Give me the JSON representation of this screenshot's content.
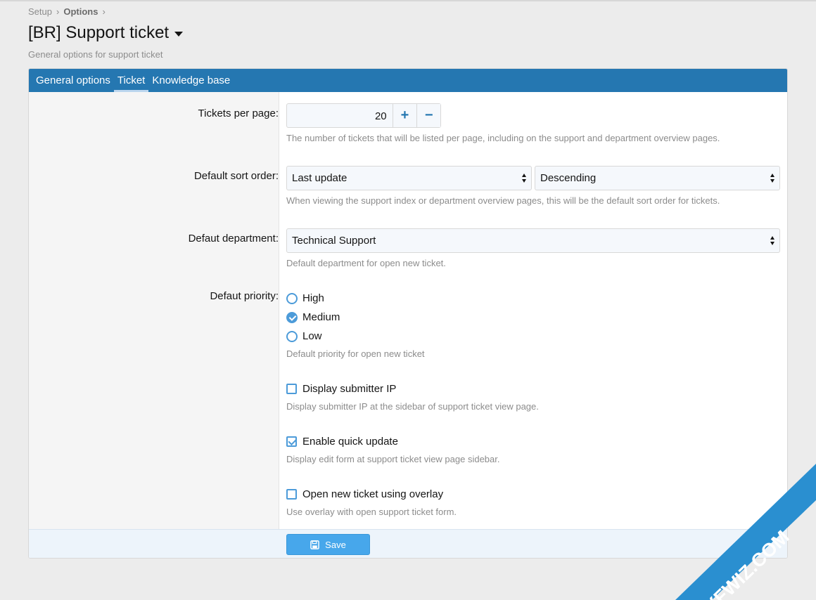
{
  "breadcrumb": {
    "items": [
      "Setup",
      "Options"
    ]
  },
  "page": {
    "title": "[BR] Support ticket",
    "description": "General options for support ticket"
  },
  "tabs": [
    "General options",
    "Ticket",
    "Knowledge base"
  ],
  "active_tab": "Ticket",
  "fields": {
    "tickets_per_page": {
      "label": "Tickets per page:",
      "value": "20",
      "hint": "The number of tickets that will be listed per page, including on the support and department overview pages."
    },
    "sort_order": {
      "label": "Default sort order:",
      "order_value": "Last update",
      "direction_value": "Descending",
      "hint": "When viewing the support index or department overview pages, this will be the default sort order for tickets."
    },
    "department": {
      "label": "Defaut department:",
      "value": "Technical Support",
      "hint": "Default department for open new ticket."
    },
    "priority": {
      "label": "Defaut priority:",
      "options": [
        "High",
        "Medium",
        "Low"
      ],
      "selected": "Medium",
      "hint": "Default priority for open new ticket"
    },
    "display_ip": {
      "label": "Display submitter IP",
      "checked": false,
      "hint": "Display submitter IP at the sidebar of support ticket view page."
    },
    "quick_update": {
      "label": "Enable quick update",
      "checked": true,
      "hint": "Display edit form at support ticket view page sidebar."
    },
    "overlay": {
      "label": "Open new ticket using overlay",
      "checked": false,
      "hint": "Use overlay with open support ticket form."
    }
  },
  "footer": {
    "save_label": "Save"
  },
  "watermark": {
    "text": "XFWIZ.COM"
  },
  "colors": {
    "accent": "#2577b1",
    "control": "#4c9bd9",
    "button": "#47a7eb"
  }
}
